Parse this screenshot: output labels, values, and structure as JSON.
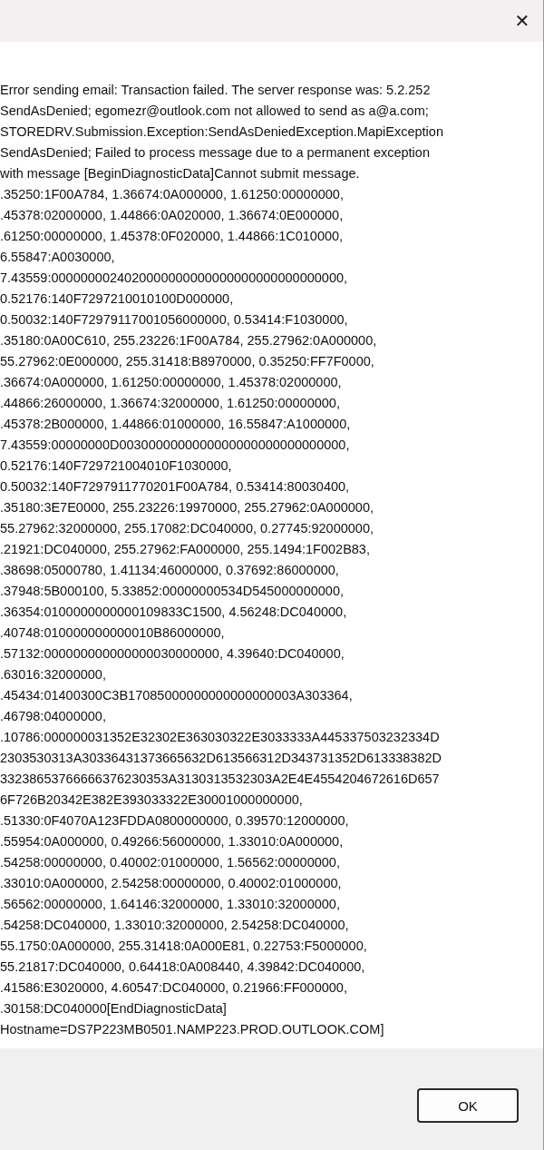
{
  "window": {
    "close_glyph": "✕"
  },
  "message_lines": [
    "Error sending email: Transaction failed. The server response was: 5.2.252",
    "SendAsDenied; egomezr@outlook.com not allowed to send as a@a.com;",
    "STOREDRV.Submission.Exception:SendAsDeniedException.MapiException",
    "SendAsDenied; Failed to process message due to a permanent exception",
    "with message [BeginDiagnosticData]Cannot submit message.",
    ".35250:1F00A784, 1.36674:0A000000, 1.61250:00000000,",
    ".45378:02000000, 1.44866:0A020000, 1.36674:0E000000,",
    ".61250:00000000, 1.45378:0F020000, 1.44866:1C010000,",
    "6.55847:A0030000,",
    "7.43559:0000000024020000000000000000000000000000,",
    "0.52176:140F7297210010100D000000,",
    "0.50032:140F72979117001056000000, 0.53414:F1030000,",
    ".35180:0A00C610, 255.23226:1F00A784, 255.27962:0A000000,",
    "55.27962:0E000000, 255.31418:B8970000, 0.35250:FF7F0000,",
    ".36674:0A000000, 1.61250:00000000, 1.45378:02000000,",
    ".44866:26000000, 1.36674:32000000, 1.61250:00000000,",
    ".45378:2B000000, 1.44866:01000000, 16.55847:A1000000,",
    "7.43559:00000000D0030000000000000000000000000000,",
    "0.52176:140F729721004010F1030000,",
    "0.50032:140F7297911770201F00A784, 0.53414:80030400,",
    ".35180:3E7E0000, 255.23226:19970000, 255.27962:0A000000,",
    "55.27962:32000000, 255.17082:DC040000, 0.27745:92000000,",
    ".21921:DC040000, 255.27962:FA000000, 255.1494:1F002B83,",
    ".38698:05000780, 1.41134:46000000, 0.37692:86000000,",
    ".37948:5B000100, 5.33852:00000000534D545000000000,",
    ".36354:0100000000000109833C1500, 4.56248:DC040000,",
    ".40748:010000000000010B86000000,",
    ".57132:000000000000000030000000, 4.39640:DC040000,",
    ".63016:32000000,",
    ".45434:01400300C3B17085000000000000000003A303364,",
    ".46798:04000000,",
    ".10786:000000031352E32302E363030322E3033333A445337503232334D",
    "2303530313A30336431373665632D613566312D343731352D613338382D",
    "33238653766666376230353A3130313532303A2E4E4554204672616D657",
    "6F726B20342E382E393033322E30001000000000,",
    ".51330:0F4070A123FDDA0800000000, 0.39570:12000000,",
    ".55954:0A000000, 0.49266:56000000, 1.33010:0A000000,",
    ".54258:00000000, 0.40002:01000000, 1.56562:00000000,",
    ".33010:0A000000, 2.54258:00000000, 0.40002:01000000,",
    ".56562:00000000, 1.64146:32000000, 1.33010:32000000,",
    ".54258:DC040000, 1.33010:32000000, 2.54258:DC040000,",
    "55.1750:0A000000, 255.31418:0A000E81, 0.22753:F5000000,",
    "55.21817:DC040000, 0.64418:0A008440, 4.39842:DC040000,",
    ".41586:E3020000, 4.60547:DC040000, 0.21966:FF000000,",
    ".30158:DC040000[EndDiagnosticData]",
    "Hostname=DS7P223MB0501.NAMP223.PROD.OUTLOOK.COM]"
  ],
  "buttons": [
    "OK"
  ]
}
